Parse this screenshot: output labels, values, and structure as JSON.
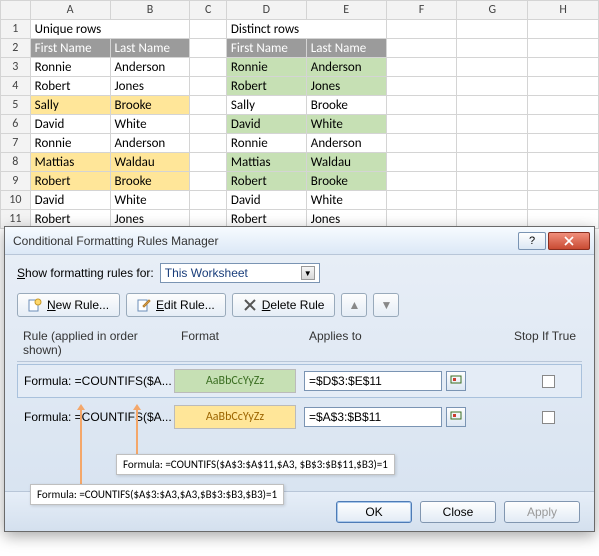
{
  "columns": [
    "A",
    "B",
    "C",
    "D",
    "E",
    "F",
    "G",
    "H"
  ],
  "row_numbers": [
    1,
    2,
    3,
    4,
    5,
    6,
    7,
    8,
    9,
    10,
    11
  ],
  "titles": {
    "unique": "Unique rows",
    "distinct": "Distinct rows"
  },
  "headers": {
    "first": "First Name",
    "last": "Last Name"
  },
  "rows": [
    {
      "first": "Ronnie",
      "last": "Anderson",
      "u_hl": "",
      "d_hl": "green"
    },
    {
      "first": "Robert",
      "last": "Jones",
      "u_hl": "",
      "d_hl": "green"
    },
    {
      "first": "Sally",
      "last": "Brooke",
      "u_hl": "yellow",
      "d_hl": ""
    },
    {
      "first": "David",
      "last": "White",
      "u_hl": "",
      "d_hl": "green"
    },
    {
      "first": "Ronnie",
      "last": "Anderson",
      "u_hl": "",
      "d_hl": ""
    },
    {
      "first": "Mattias",
      "last": "Waldau",
      "u_hl": "yellow",
      "d_hl": "green"
    },
    {
      "first": "Robert",
      "last": "Brooke",
      "u_hl": "yellow",
      "d_hl": "green"
    },
    {
      "first": "David",
      "last": "White",
      "u_hl": "",
      "d_hl": ""
    },
    {
      "first": "Robert",
      "last": "Jones",
      "u_hl": "",
      "d_hl": ""
    }
  ],
  "dialog": {
    "title": "Conditional Formatting Rules Manager",
    "show_label_pre": "S",
    "show_label": "how formatting rules for:",
    "scope": "This Worksheet",
    "buttons": {
      "new_u": "N",
      "new": "ew Rule...",
      "edit_u": "E",
      "edit": "dit Rule...",
      "delete_u": "D",
      "delete": "elete Rule",
      "up": "▲",
      "down": "▼"
    },
    "cols": {
      "rule": "Rule (applied in order shown)",
      "format": "Format",
      "applies": "Applies to",
      "stop": "Stop If True"
    },
    "sample": "AaBbCcYyZz",
    "rules": [
      {
        "label": "Formula: =COUNTIFS($A...",
        "fmt": "green",
        "applies": "=$D$3:$E$11"
      },
      {
        "label": "Formula: =COUNTIFS($A...",
        "fmt": "yellow",
        "applies": "=$A$3:$B$11"
      }
    ],
    "footer": {
      "ok": "OK",
      "close": "Close",
      "apply": "Apply"
    }
  },
  "callouts": {
    "top": "Formula: =COUNTIFS($A$3:$A$11,$A3, $B$3:$B$11,$B3)=1",
    "bottom": "Formula: =COUNTIFS($A$3:$A3,$A3,$B$3:$B3,$B3)=1"
  }
}
